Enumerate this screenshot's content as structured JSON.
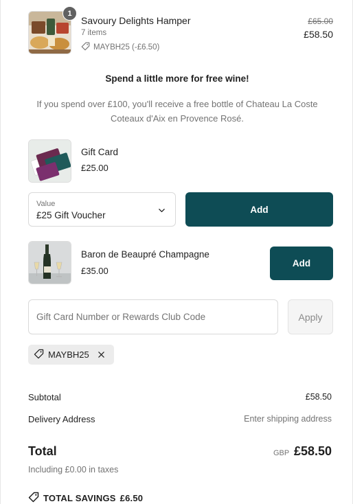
{
  "line_item": {
    "quantity_badge": "1",
    "title": "Savoury Delights Hamper",
    "items_count": "7 items",
    "discount_label": "MAYBH25 (-£6.50)",
    "original_price": "£65.00",
    "price": "£58.50"
  },
  "promo": {
    "heading": "Spend a little more for free wine!",
    "text": "If you spend over £100, you'll receive a free bottle of Chateau La Coste Coteaux d'Aix en Provence Rosé."
  },
  "upsells": [
    {
      "title": "Gift Card",
      "price": "£25.00",
      "select_label": "Value",
      "select_value": "£25 Gift Voucher",
      "add_label": "Add"
    },
    {
      "title": "Baron de Beaupré Champagne",
      "price": "£35.00",
      "add_label": "Add"
    }
  ],
  "discount_form": {
    "placeholder": "Gift Card Number or Rewards Club Code",
    "apply_label": "Apply",
    "applied_code": "MAYBH25"
  },
  "summary": {
    "subtotal_label": "Subtotal",
    "subtotal_value": "£58.50",
    "delivery_label": "Delivery Address",
    "delivery_value": "Enter shipping address",
    "total_label": "Total",
    "currency": "GBP",
    "total_value": "£58.50",
    "taxes_text": "Including £0.00 in taxes",
    "savings_label": "TOTAL SAVINGS",
    "savings_value": "£6.50"
  },
  "colors": {
    "primary_button": "#0e4c55",
    "muted_text": "#737373"
  },
  "icons": [
    "tag-icon",
    "chevron-down-icon",
    "close-icon"
  ]
}
